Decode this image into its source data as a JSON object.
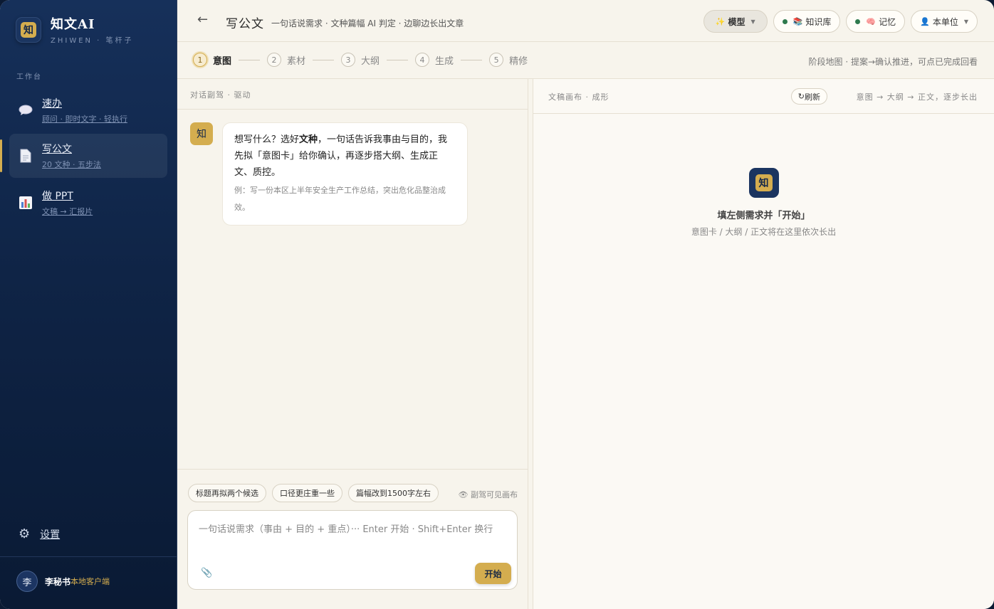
{
  "brand": {
    "logo_glyph": "知",
    "name": "知文AI",
    "subtitle": "ZHIWEN · 笔杆子"
  },
  "sidebar": {
    "section_label": "工作台",
    "items": [
      {
        "title": "速办",
        "sub": "顾问 · 即时文字 · 轻执行",
        "icon": "chat-bubble-icon"
      },
      {
        "title": "写公文",
        "sub": "20 文种 · 五步法",
        "icon": "document-icon",
        "active": true
      },
      {
        "title": "做 PPT",
        "sub": "文稿 → 汇报片",
        "icon": "bar-chart-icon"
      }
    ],
    "settings_label": "设置",
    "user": {
      "avatar": "李",
      "name": "李秘书",
      "tag": "本地客户端"
    }
  },
  "header": {
    "back": "←",
    "title": "写公文",
    "subtitle": "一句话说需求 · 文种篇幅 AI 判定 · 边聊边长出文章",
    "model_label": "模型",
    "kb_label": "知识库",
    "memory_label": "记忆",
    "unit_label": "本单位"
  },
  "steps": {
    "items": [
      {
        "num": "1",
        "label": "意图"
      },
      {
        "num": "2",
        "label": "素材"
      },
      {
        "num": "3",
        "label": "大纲"
      },
      {
        "num": "4",
        "label": "生成"
      },
      {
        "num": "5",
        "label": "精修"
      }
    ],
    "hint": "阶段地图 · 提案→确认推进，可点已完成回看"
  },
  "chat": {
    "head": "对话副驾 · 驱动",
    "avatar": "知",
    "msg_part1": "想写什么？选好",
    "msg_bold": "文种",
    "msg_part2": "，一句话告诉我事由与目的，我先拟「意图卡」给你确认，再逐步搭大纲、生成正文、质控。",
    "example": "例：写一份本区上半年安全生产工作总结，突出危化品整治成效。",
    "chips": [
      "标题再拟两个候选",
      "口径更庄重一些",
      "篇幅改到1500字左右"
    ],
    "visible_note": "副驾可见画布",
    "placeholder": "一句话说需求（事由 + 目的 + 重点）··· Enter 开始 · Shift+Enter 换行",
    "start_label": "开始"
  },
  "canvas": {
    "title": "文稿画布 · 成形",
    "refresh_label": "刷新",
    "flow": "意图 → 大纲 → 正文，逐步长出",
    "empty_title": "填左侧需求并「开始」",
    "empty_sub": "意图卡 / 大纲 / 正文将在这里依次长出"
  },
  "colors": {
    "accent": "#d4ad4f",
    "sidebar": "#0f2446",
    "background": "#f7f4ec"
  }
}
